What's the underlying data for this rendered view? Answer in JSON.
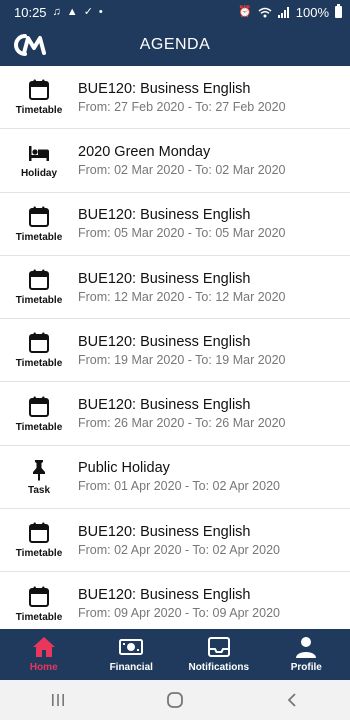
{
  "status_bar": {
    "time": "10:25",
    "battery": "100%"
  },
  "header": {
    "title": "AGENDA",
    "logo": "cm-logo"
  },
  "agenda": {
    "items": [
      {
        "type": "Timetable",
        "icon": "calendar-icon",
        "title": "BUE120: Business English",
        "dates": "From: 27 Feb 2020 - To: 27 Feb 2020"
      },
      {
        "type": "Holiday",
        "icon": "bed-icon",
        "title": "2020 Green Monday",
        "dates": "From: 02 Mar 2020 - To: 02 Mar 2020"
      },
      {
        "type": "Timetable",
        "icon": "calendar-icon",
        "title": "BUE120: Business English",
        "dates": "From: 05 Mar 2020 - To: 05 Mar 2020"
      },
      {
        "type": "Timetable",
        "icon": "calendar-icon",
        "title": "BUE120: Business English",
        "dates": "From: 12 Mar 2020 - To: 12 Mar 2020"
      },
      {
        "type": "Timetable",
        "icon": "calendar-icon",
        "title": "BUE120: Business English",
        "dates": "From: 19 Mar 2020 - To: 19 Mar 2020"
      },
      {
        "type": "Timetable",
        "icon": "calendar-icon",
        "title": "BUE120: Business English",
        "dates": "From: 26 Mar 2020 - To: 26 Mar 2020"
      },
      {
        "type": "Task",
        "icon": "pin-icon",
        "title": "Public Holiday",
        "dates": "From: 01 Apr 2020 - To: 02 Apr 2020"
      },
      {
        "type": "Timetable",
        "icon": "calendar-icon",
        "title": "BUE120: Business English",
        "dates": "From: 02 Apr 2020 - To: 02 Apr 2020"
      },
      {
        "type": "Timetable",
        "icon": "calendar-icon",
        "title": "BUE120: Business English",
        "dates": "From: 09 Apr 2020 - To: 09 Apr 2020"
      }
    ]
  },
  "bottom_nav": {
    "items": [
      {
        "label": "Home",
        "icon": "home-icon",
        "active": true
      },
      {
        "label": "Financial",
        "icon": "money-icon",
        "active": false
      },
      {
        "label": "Notifications",
        "icon": "inbox-icon",
        "active": false
      },
      {
        "label": "Profile",
        "icon": "user-icon",
        "active": false
      }
    ]
  },
  "colors": {
    "primary": "#1f3a5c",
    "active": "#e8365c",
    "secondary_text": "#777777"
  }
}
